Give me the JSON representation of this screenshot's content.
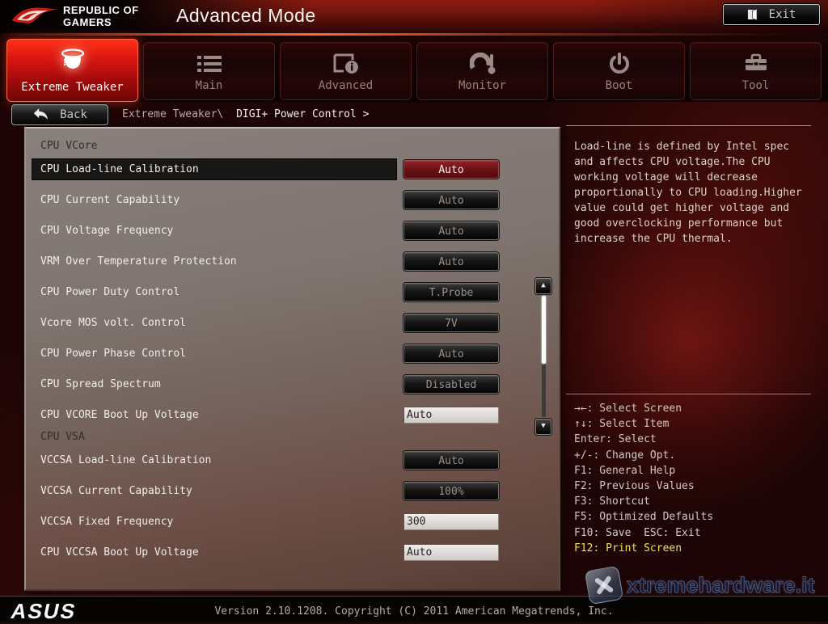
{
  "header": {
    "brand_top": "REPUBLIC OF",
    "brand_bottom": "GAMERS",
    "title": "Advanced Mode",
    "exit_label": "Exit"
  },
  "tabs": [
    {
      "label": "Extreme Tweaker",
      "icon": "extreme-tweaker-icon",
      "active": true
    },
    {
      "label": "Main",
      "icon": "list-icon",
      "active": false
    },
    {
      "label": "Advanced",
      "icon": "page-info-icon",
      "active": false
    },
    {
      "label": "Monitor",
      "icon": "gauge-thermometer-icon",
      "active": false
    },
    {
      "label": "Boot",
      "icon": "power-icon",
      "active": false
    },
    {
      "label": "Tool",
      "icon": "toolbox-icon",
      "active": false
    }
  ],
  "breadcrumb": {
    "back_label": "Back",
    "path_parent": "Extreme Tweaker\\",
    "path_current": "DIGI+ Power Control >"
  },
  "settings": {
    "groups": [
      {
        "header": "CPU VCore",
        "items": [
          {
            "label": "CPU Load-line Calibration",
            "value": "Auto",
            "control": "button",
            "selected": true
          },
          {
            "label": "CPU Current Capability",
            "value": "Auto",
            "control": "button",
            "selected": false
          },
          {
            "label": "CPU Voltage Frequency",
            "value": "Auto",
            "control": "button",
            "selected": false
          },
          {
            "label": "VRM Over Temperature Protection",
            "value": "Auto",
            "control": "button",
            "selected": false
          },
          {
            "label": "CPU Power Duty Control",
            "value": "T.Probe",
            "control": "button",
            "selected": false
          },
          {
            "label": "Vcore MOS volt. Control",
            "value": "7V",
            "control": "button",
            "selected": false
          },
          {
            "label": "CPU Power Phase Control",
            "value": "Auto",
            "control": "button",
            "selected": false
          },
          {
            "label": "CPU Spread Spectrum",
            "value": "Disabled",
            "control": "button",
            "selected": false
          },
          {
            "label": "CPU VCORE Boot Up Voltage",
            "value": "Auto",
            "control": "input",
            "selected": false
          }
        ]
      },
      {
        "header": "CPU VSA",
        "items": [
          {
            "label": "VCCSA Load-line Calibration",
            "value": "Auto",
            "control": "button",
            "selected": false
          },
          {
            "label": "VCCSA Current Capability",
            "value": "100%",
            "control": "button",
            "selected": false
          },
          {
            "label": "VCCSA Fixed Frequency",
            "value": "300",
            "control": "input",
            "selected": false
          },
          {
            "label": "CPU VCCSA Boot Up Voltage",
            "value": "Auto",
            "control": "input",
            "selected": false
          }
        ]
      }
    ]
  },
  "help_panel": {
    "text": "Load-line is defined by Intel spec\nand affects CPU voltage.The CPU\nworking voltage will decrease\nproportionally to CPU loading.Higher\nvalue could get higher voltage and\ngood overclocking performance but\nincrease the CPU thermal."
  },
  "shortcuts": {
    "lines": [
      "→←: Select Screen",
      "↑↓: Select Item",
      "Enter: Select",
      "+/-: Change Opt.",
      "F1: General Help",
      "F2: Previous Values",
      "F3: Shortcut",
      "F5: Optimized Defaults",
      "F10: Save  ESC: Exit",
      "F12: Print Screen"
    ]
  },
  "icons": {
    "scroll_up": "▲",
    "scroll_down": "▼"
  },
  "footer": {
    "brand": "ASUS",
    "version_text": "Version 2.10.1208. Copyright (C) 2011 American Megatrends, Inc."
  },
  "watermark": {
    "text": "xtremehardware.it"
  },
  "colors": {
    "accent_red": "#c01414",
    "selected_value_bg": "#6e1216",
    "highlight_yellow": "#f2e04e"
  }
}
